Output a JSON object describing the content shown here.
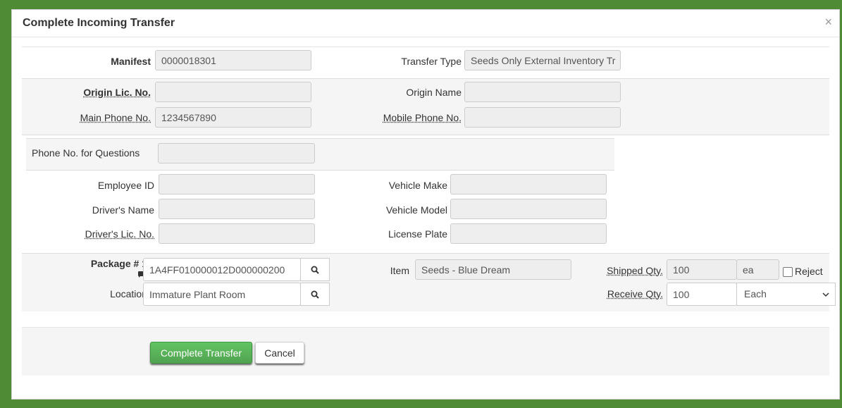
{
  "dialog": {
    "title": "Complete Incoming Transfer",
    "close_symbol": "×"
  },
  "manifest": {
    "manifest_label": "Manifest",
    "manifest_value": "0000018301",
    "transfer_type_label": "Transfer Type",
    "transfer_type_value": "Seeds Only External Inventory Tr"
  },
  "origin": {
    "origin_lic_label": "Origin Lic. No.",
    "origin_lic_value": "",
    "origin_name_label": "Origin Name",
    "origin_name_value": "",
    "main_phone_label": "Main Phone No.",
    "main_phone_value": "1234567890",
    "mobile_phone_label": "Mobile Phone No.",
    "mobile_phone_value": ""
  },
  "questions": {
    "phone_questions_label": "Phone No. for Questions",
    "phone_questions_value": ""
  },
  "driver": {
    "employee_id_label": "Employee ID",
    "employee_id_value": "",
    "drivers_name_label": "Driver's Name",
    "drivers_name_value": "",
    "drivers_lic_label": "Driver's Lic. No.",
    "drivers_lic_value": "",
    "vehicle_make_label": "Vehicle Make",
    "vehicle_make_value": "",
    "vehicle_model_label": "Vehicle Model",
    "vehicle_model_value": "",
    "license_plate_label": "License Plate",
    "license_plate_value": ""
  },
  "package": {
    "package_label": "Package # 1",
    "package_value": "1A4FF010000012D000000200",
    "location_label": "Location",
    "location_value": "Immature Plant Room",
    "item_label": "Item",
    "item_value": "Seeds - Blue Dream",
    "shipped_qty_label": "Shipped Qty.",
    "shipped_qty_value": "100",
    "shipped_unit": "ea",
    "reject_label": "Reject",
    "receive_qty_label": "Receive Qty.",
    "receive_qty_value": "100",
    "receive_unit_selected": "Each"
  },
  "actions": {
    "complete_label": "Complete Transfer",
    "cancel_label": "Cancel"
  },
  "colors": {
    "frame_green": "#4f8a35",
    "primary_button": "#5cb85c",
    "section_bg": "#f5f5f5"
  },
  "icons": [
    "search-icon",
    "comment-icon",
    "chevron-down-icon",
    "close-icon"
  ]
}
